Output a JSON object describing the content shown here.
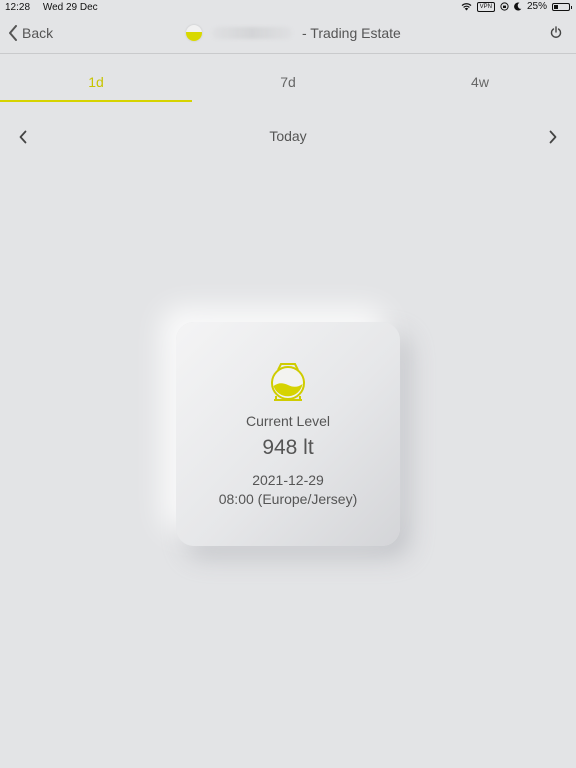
{
  "status_bar": {
    "time": "12:28",
    "date": "Wed 29 Dec",
    "vpn": "VPN",
    "battery_percent": "25%",
    "battery_level": 0.25
  },
  "nav": {
    "back_label": "Back",
    "title": "- Trading Estate"
  },
  "tabs": [
    {
      "label": "1d",
      "active": true
    },
    {
      "label": "7d",
      "active": false
    },
    {
      "label": "4w",
      "active": false
    }
  ],
  "date_nav": {
    "label": "Today"
  },
  "card": {
    "title": "Current Level",
    "value": "948 lt",
    "date": "2021-12-29",
    "time": "08:00 (Europe/Jersey)"
  },
  "colors": {
    "accent": "#d6d300",
    "background": "#e3e4e6",
    "text": "#555555"
  },
  "icons": {
    "wifi": "wifi-icon",
    "vpn": "vpn-icon",
    "lock_rotation": "rotation-lock-icon",
    "moon": "moon-icon",
    "battery": "battery-icon",
    "back": "chevron-left-icon",
    "power": "power-icon",
    "prev": "chevron-left-icon",
    "next": "chevron-right-icon",
    "tank": "tank-level-icon"
  }
}
